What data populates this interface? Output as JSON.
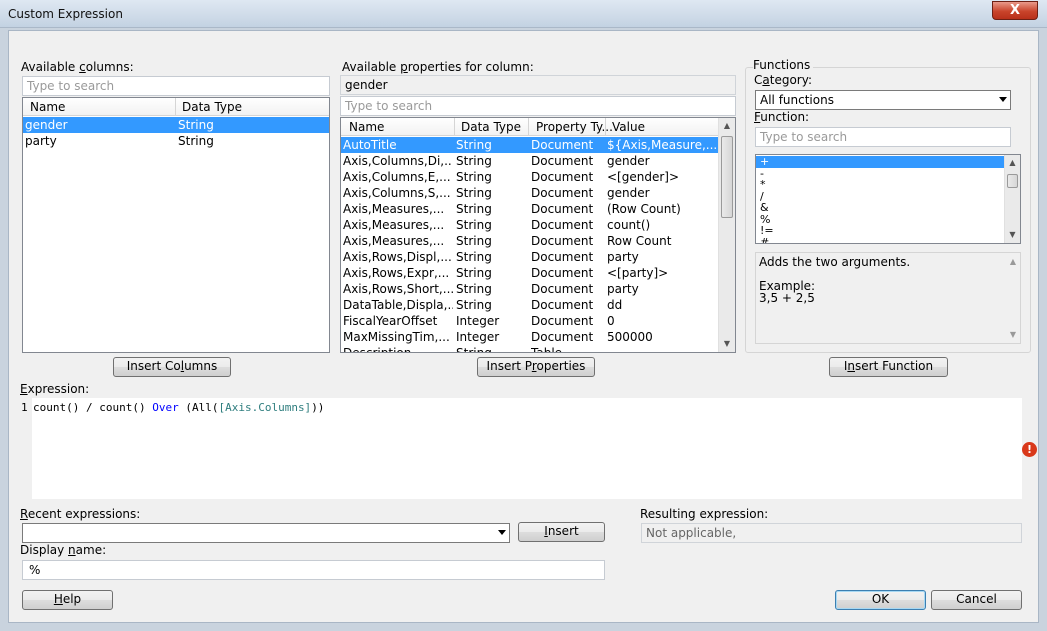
{
  "window": {
    "title": "Custom Expression",
    "close_glyph": "X"
  },
  "columns": {
    "label": "Available columns:",
    "search_placeholder": "Type to search",
    "headers": [
      "Name",
      "Data Type"
    ],
    "rows": [
      {
        "name": "gender",
        "type": "String",
        "selected": true
      },
      {
        "name": "party",
        "type": "String",
        "selected": false
      }
    ],
    "insert_button": "Insert Columns"
  },
  "properties": {
    "label": "Available properties for column:",
    "column_value": "gender",
    "search_placeholder": "Type to search",
    "headers": [
      "Name",
      "Data Type",
      "Property Ty...",
      "Value"
    ],
    "rows": [
      {
        "name": "AutoTitle",
        "type": "String",
        "ptype": "Document",
        "value": "${Axis,Measure,...",
        "selected": true
      },
      {
        "name": "Axis,Columns,Di,...",
        "type": "String",
        "ptype": "Document",
        "value": "gender"
      },
      {
        "name": "Axis,Columns,E,...",
        "type": "String",
        "ptype": "Document",
        "value": "<[gender]>"
      },
      {
        "name": "Axis,Columns,S,...",
        "type": "String",
        "ptype": "Document",
        "value": "gender"
      },
      {
        "name": "Axis,Measures,...",
        "type": "String",
        "ptype": "Document",
        "value": "(Row Count)"
      },
      {
        "name": "Axis,Measures,...",
        "type": "String",
        "ptype": "Document",
        "value": "count()"
      },
      {
        "name": "Axis,Measures,...",
        "type": "String",
        "ptype": "Document",
        "value": "Row Count"
      },
      {
        "name": "Axis,Rows,Displ,...",
        "type": "String",
        "ptype": "Document",
        "value": "party"
      },
      {
        "name": "Axis,Rows,Expr,...",
        "type": "String",
        "ptype": "Document",
        "value": "<[party]>"
      },
      {
        "name": "Axis,Rows,Short,...",
        "type": "String",
        "ptype": "Document",
        "value": "party"
      },
      {
        "name": "DataTable,Displa,...",
        "type": "String",
        "ptype": "Document",
        "value": "dd"
      },
      {
        "name": "FiscalYearOffset",
        "type": "Integer",
        "ptype": "Document",
        "value": "0"
      },
      {
        "name": "MaxMissingTim,...",
        "type": "Integer",
        "ptype": "Document",
        "value": "500000"
      },
      {
        "name": "Description",
        "type": "String",
        "ptype": "Table",
        "value": ""
      }
    ],
    "insert_button": "Insert Properties"
  },
  "functions": {
    "group_label": "Functions",
    "category_label": "Category:",
    "category_value": "All functions",
    "function_label": "Function:",
    "search_placeholder": "Type to search",
    "items": [
      "+",
      "-",
      "*",
      "/",
      "&",
      "%",
      "!=",
      "#...."
    ],
    "description": "Adds the two arguments.",
    "example_label": "Example:",
    "example_value": "3,5 + 2,5",
    "insert_button": "Insert Function"
  },
  "expression": {
    "label": "Expression:",
    "line_number": "1",
    "tokens": {
      "t1": "count() / count() ",
      "t2": "Over",
      "t3": " (All(",
      "t4": "[Axis.Columns]",
      "t5": "))"
    },
    "error_glyph": "!"
  },
  "recent": {
    "label": "Recent expressions:",
    "value": "",
    "insert_button": "Insert"
  },
  "resulting": {
    "label": "Resulting expression:",
    "value": "Not applicable,"
  },
  "display_name": {
    "label": "Display name:",
    "value": "%"
  },
  "footer": {
    "help": "Help",
    "ok": "OK",
    "cancel": "Cancel"
  },
  "colors": {
    "selection": "#3399ff",
    "keyword": "#0000ff",
    "argument": "#2e7d7e",
    "error": "#d9391b"
  }
}
